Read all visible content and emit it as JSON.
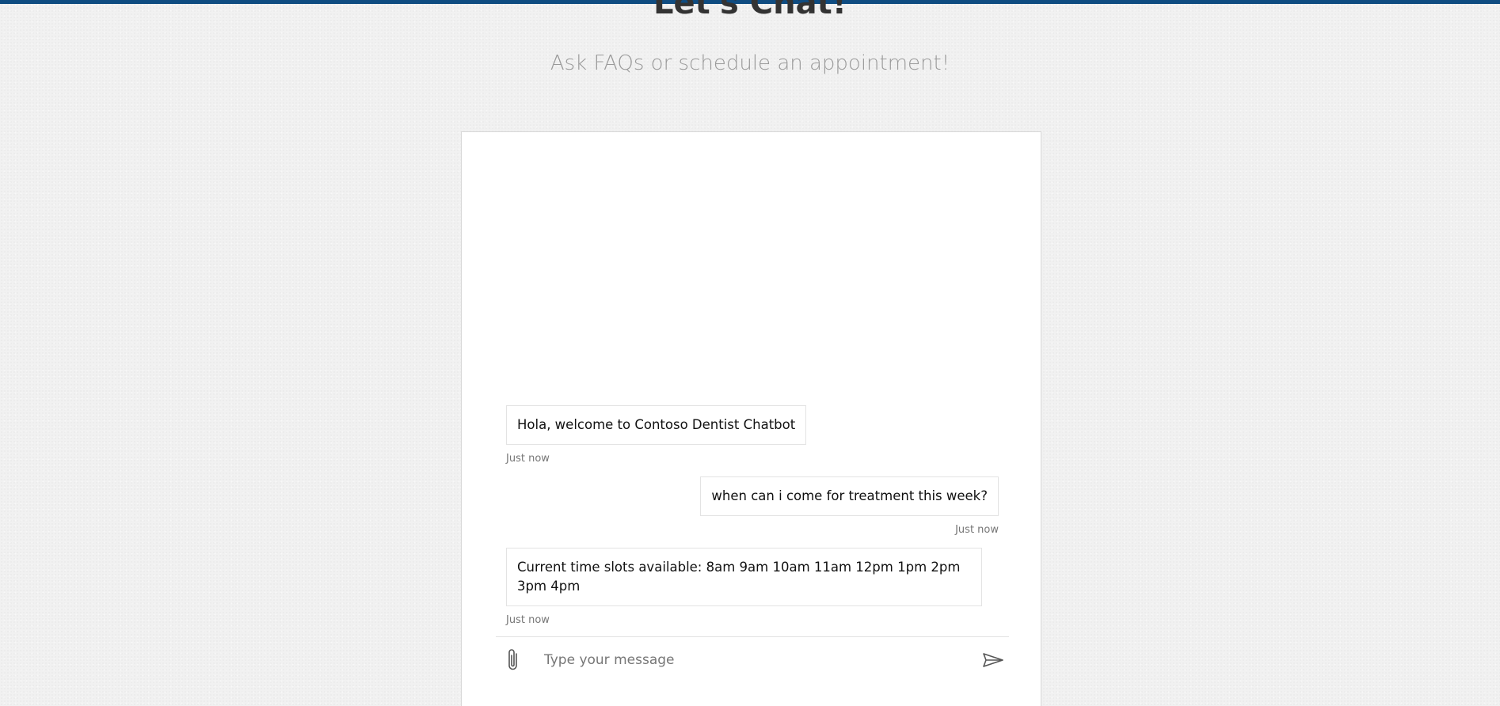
{
  "header": {
    "title": "Let's Chat!",
    "subtitle": "Ask FAQs or schedule an appointment!"
  },
  "colors": {
    "accent_bar": "#0f4c81",
    "page_background": "#f1f1f1",
    "panel_background": "#ffffff",
    "title_text": "#333333",
    "subtitle_text": "#9a9a9a",
    "timestamp_text": "#767676"
  },
  "chat": {
    "messages": [
      {
        "sender": "bot",
        "text": "Hola, welcome to Contoso Dentist Chatbot",
        "timestamp": "Just now"
      },
      {
        "sender": "user",
        "text": "when can i come for treatment this week?",
        "timestamp": "Just now"
      },
      {
        "sender": "bot",
        "text": "Current time slots available: 8am 9am 10am 11am 12pm 1pm 2pm 3pm 4pm",
        "timestamp": "Just now"
      }
    ]
  },
  "composer": {
    "placeholder": "Type your message",
    "attach_icon": "paperclip-icon",
    "send_icon": "send-icon"
  }
}
